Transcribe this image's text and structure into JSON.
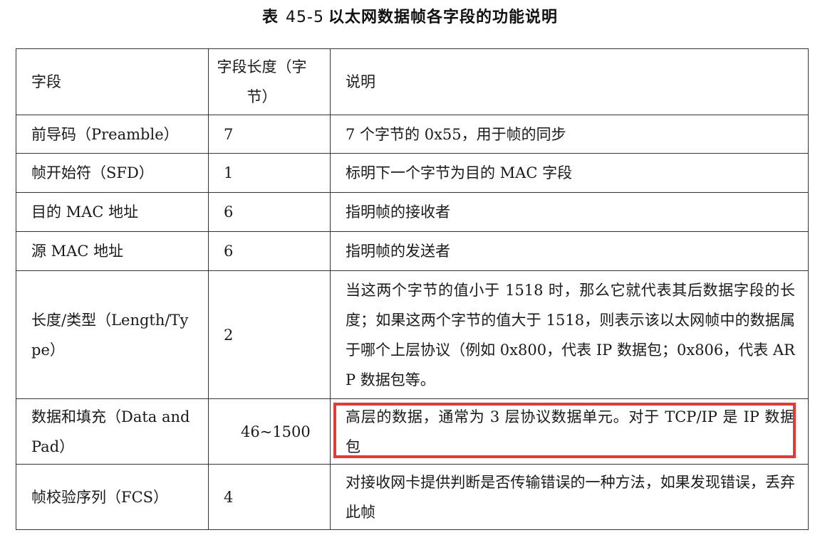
{
  "caption": {
    "prefix": "表",
    "number": "45-5",
    "title": "以太网数据帧各字段的功能说明"
  },
  "headers": {
    "field": "字段",
    "length": "字段长度（字节）",
    "description": "说明"
  },
  "rows": [
    {
      "field": "前导码（Preamble）",
      "length": "7",
      "description": "7 个字节的 0x55，用于帧的同步"
    },
    {
      "field": "帧开始符（SFD）",
      "length": "1",
      "description": "标明下一个字节为目的 MAC 字段"
    },
    {
      "field": "目的 MAC 地址",
      "length": "6",
      "description": "指明帧的接收者"
    },
    {
      "field": "源 MAC 地址",
      "length": "6",
      "description": "指明帧的发送者"
    },
    {
      "field": "长度/类型（Length/Type）",
      "length": "2",
      "description": "当这两个字节的值小于 1518 时，那么它就代表其后数据字段的长度；如果这两个字节的值大于 1518，则表示该以太网帧中的数据属于哪个上层协议（例如 0x800，代表 IP 数据包；0x806，代表 ARP 数据包等。"
    },
    {
      "field": "数据和填充（Data and Pad）",
      "length": "46~1500",
      "description": "高层的数据，通常为 3 层协议数据单元。对于 TCP/IP 是 IP 数据包"
    },
    {
      "field": "帧校验序列（FCS）",
      "length": "4",
      "description": "对接收网卡提供判断是否传输错误的一种方法，如果发现错误，丢弃此帧"
    }
  ],
  "highlight": {
    "color": "#e53935"
  }
}
